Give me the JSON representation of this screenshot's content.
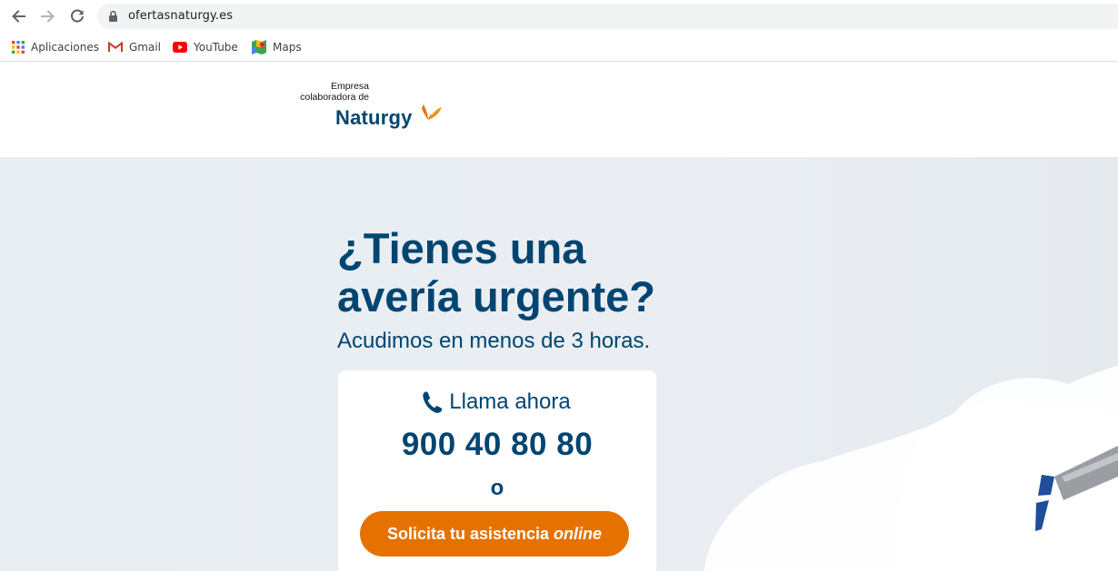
{
  "browser": {
    "url": "ofertasnaturgy.es",
    "bookmarks": [
      {
        "label": "Aplicaciones",
        "icon": "apps-grid-icon"
      },
      {
        "label": "Gmail",
        "icon": "gmail-icon"
      },
      {
        "label": "YouTube",
        "icon": "youtube-icon"
      },
      {
        "label": "Maps",
        "icon": "maps-icon"
      }
    ]
  },
  "header": {
    "collab_line1": "Empresa",
    "collab_line2": "colaboradora de",
    "brand": "Naturgy"
  },
  "hero": {
    "headline_line1": "¿Tienes una",
    "headline_line2": "avería urgente?",
    "subheadline": "Acudimos en menos de 3 horas."
  },
  "contact_card": {
    "call_label": "Llama ahora",
    "phone_number": "900 40 80 80",
    "or_text": "o",
    "cta_prefix": "Solicita tu asistencia",
    "cta_emphasis": "online"
  },
  "colors": {
    "brand_blue": "#004571",
    "brand_orange": "#e57200",
    "hero_background": "#e8edf2"
  }
}
